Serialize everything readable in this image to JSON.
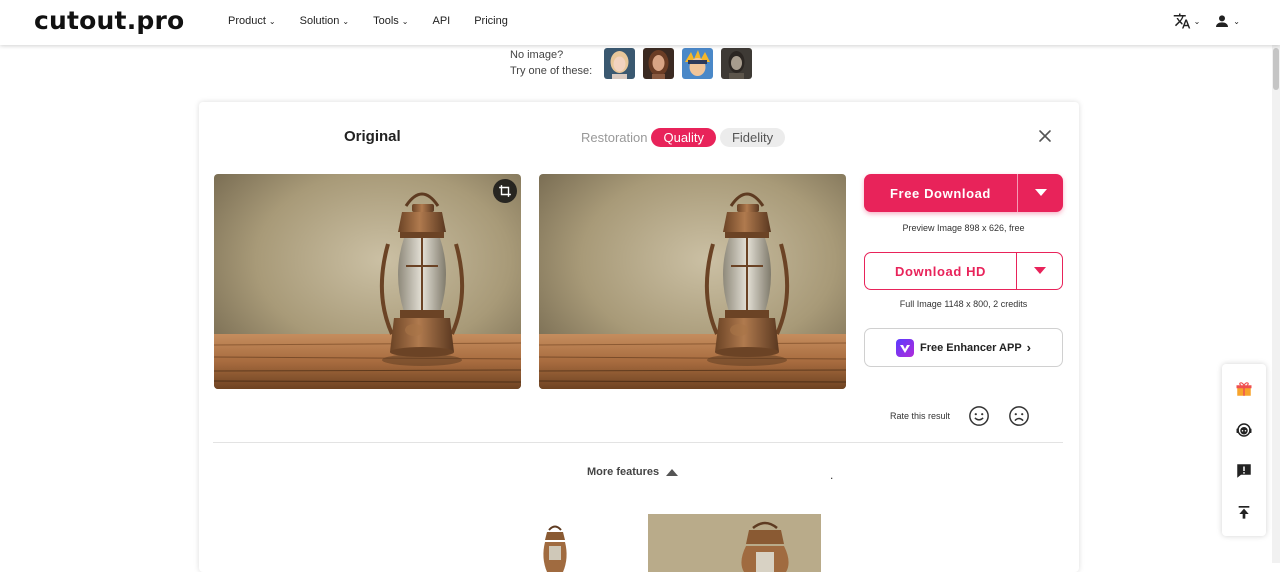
{
  "header": {
    "logo": "cutout.pro",
    "nav": [
      {
        "label": "Product",
        "caret": true
      },
      {
        "label": "Solution",
        "caret": true
      },
      {
        "label": "Tools",
        "caret": true
      },
      {
        "label": "API",
        "caret": false
      },
      {
        "label": "Pricing",
        "caret": false
      }
    ],
    "icons": [
      "translate-icon",
      "user-icon"
    ]
  },
  "samples": {
    "line1": "No image?",
    "line2": "Try one of these:",
    "thumbnails": [
      "sample-blonde-woman",
      "sample-brunette-woman",
      "sample-anime-character",
      "sample-vintage-portrait"
    ]
  },
  "editor": {
    "original_label": "Original",
    "mode_label": "Restoration",
    "modes": [
      {
        "label": "Quality",
        "active": true
      },
      {
        "label": "Fidelity",
        "active": false
      }
    ],
    "free_download": {
      "label": "Free Download",
      "note": "Preview Image 898 x 626, free"
    },
    "download_hd": {
      "label": "Download HD",
      "note": "Full Image 1148 x 800, 2 credits"
    },
    "enhancer_app": {
      "label": "Free Enhancer APP",
      "arrow": "›"
    },
    "rate": {
      "label": "Rate this result"
    },
    "more_features": "More features",
    "dot": "."
  },
  "floatbar": {
    "icons": [
      "gift-icon",
      "support-agent-icon",
      "feedback-icon",
      "back-to-top-icon"
    ]
  },
  "colors": {
    "accent": "#e8235a",
    "pill_inactive": "#ececec",
    "text_dark": "#222222"
  }
}
